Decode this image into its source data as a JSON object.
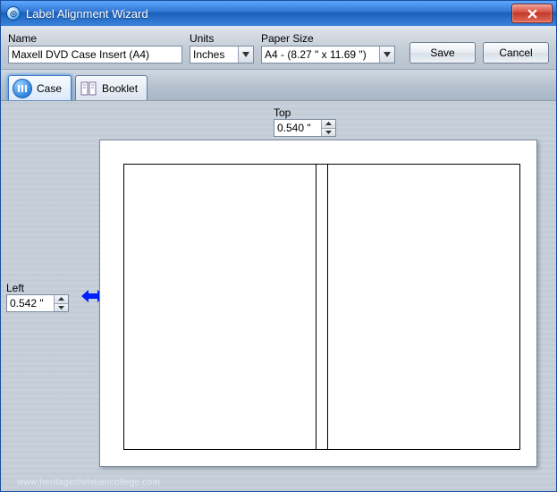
{
  "window": {
    "title": "Label Alignment Wizard"
  },
  "form": {
    "name_label": "Name",
    "name_value": "Maxell DVD Case Insert (A4)",
    "units_label": "Units",
    "units_value": "Inches",
    "paper_label": "Paper Size",
    "paper_value": "A4 - (8.27 \" x 11.69 \")",
    "save_label": "Save",
    "cancel_label": "Cancel"
  },
  "tabs": {
    "case_label": "Case",
    "booklet_label": "Booklet"
  },
  "margins": {
    "top_label": "Top",
    "top_value": "0.540 \"",
    "left_label": "Left",
    "left_value": "0.542 \""
  },
  "watermark": "www.heritagechristiancollege.com"
}
